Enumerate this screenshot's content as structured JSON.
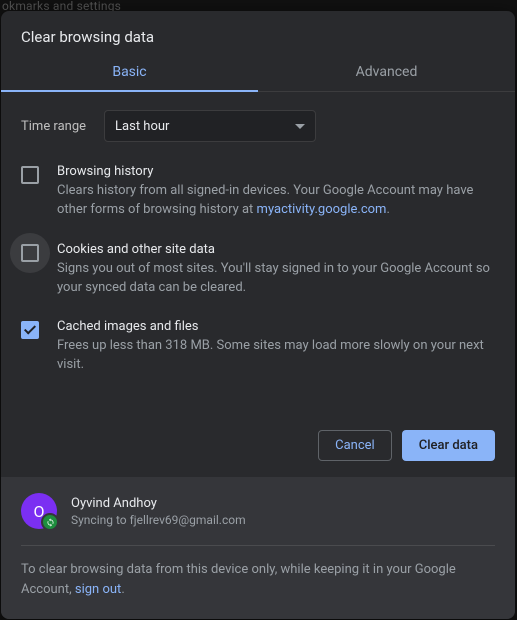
{
  "backdrop_hint": "okmarks and settings",
  "title": "Clear browsing data",
  "tabs": {
    "basic": "Basic",
    "advanced": "Advanced"
  },
  "time_range": {
    "label": "Time range",
    "value": "Last hour"
  },
  "options": {
    "history": {
      "title": "Browsing history",
      "desc_a": "Clears history from all signed-in devices. Your Google Account may have other forms of browsing history at ",
      "link": "myactivity.google.com",
      "desc_b": "."
    },
    "cookies": {
      "title": "Cookies and other site data",
      "desc": "Signs you out of most sites. You'll stay signed in to your Google Account so your synced data can be cleared."
    },
    "cache": {
      "title": "Cached images and files",
      "desc": "Frees up less than 318 MB. Some sites may load more slowly on your next visit."
    }
  },
  "buttons": {
    "cancel": "Cancel",
    "clear": "Clear data"
  },
  "account": {
    "initial": "O",
    "name": "Oyvind Andhoy",
    "sync_prefix": "Syncing to ",
    "email": "fjellrev69@gmail.com"
  },
  "footer_note": {
    "a": "To clear browsing data from this device only, while keeping it in your Google Account, ",
    "link": "sign out",
    "b": "."
  }
}
